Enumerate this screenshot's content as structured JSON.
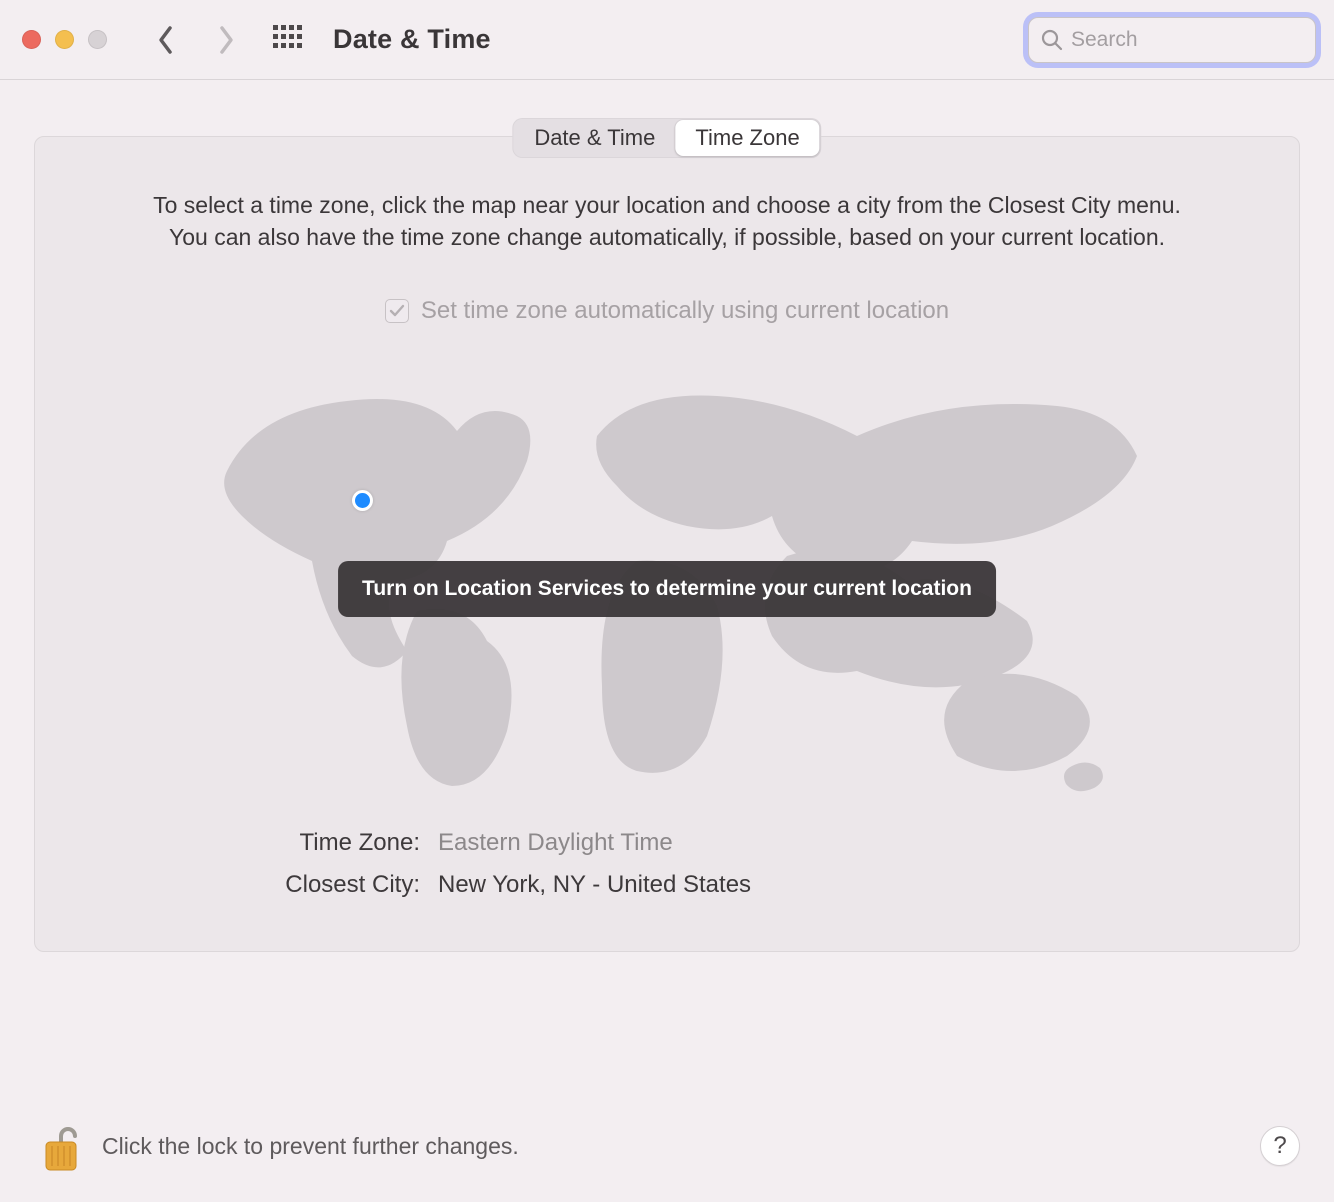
{
  "window": {
    "title": "Date & Time"
  },
  "search": {
    "placeholder": "Search",
    "value": ""
  },
  "tabs": {
    "items": [
      {
        "label": "Date & Time",
        "active": false
      },
      {
        "label": "Time Zone",
        "active": true
      }
    ]
  },
  "instructions": {
    "line1": "To select a time zone, click the map near your location and choose a city from the Closest City menu.",
    "line2": "You can also have the time zone change automatically, if possible, based on your current location."
  },
  "auto_tz": {
    "label": "Set time zone automatically using current location",
    "checked": true,
    "enabled": false
  },
  "map": {
    "toast": "Turn on Location Services to determine your current location"
  },
  "fields": {
    "time_zone_label": "Time Zone:",
    "time_zone_value": "Eastern Daylight Time",
    "closest_city_label": "Closest City:",
    "closest_city_value": "New York, NY - United States"
  },
  "footer": {
    "lock_text": "Click the lock to prevent further changes.",
    "help_label": "?"
  }
}
